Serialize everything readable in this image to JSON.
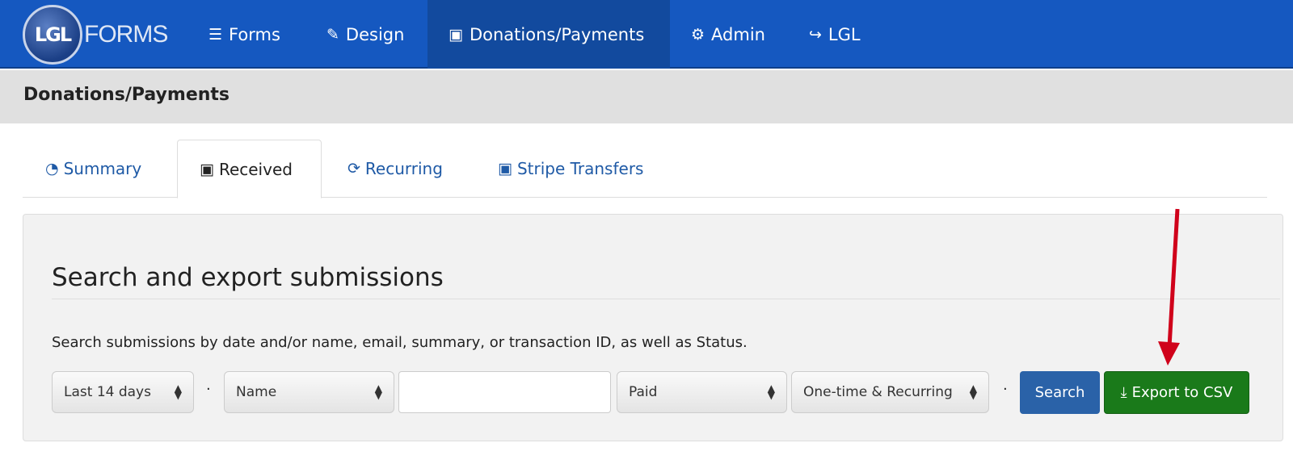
{
  "nav": {
    "logo_text": "LGL FORMS",
    "items": [
      {
        "label": "Forms",
        "icon": "list-icon"
      },
      {
        "label": "Design",
        "icon": "pencil-icon"
      },
      {
        "label": "Donations/Payments",
        "icon": "money-icon",
        "active": true
      },
      {
        "label": "Admin",
        "icon": "gear-icon"
      },
      {
        "label": "LGL",
        "icon": "share-icon"
      }
    ]
  },
  "page_title": "Donations/Payments",
  "tabs": [
    {
      "label": "Summary",
      "icon": "dashboard-icon"
    },
    {
      "label": "Received",
      "icon": "money-icon",
      "active": true
    },
    {
      "label": "Recurring",
      "icon": "refresh-icon"
    },
    {
      "label": "Stripe Transfers",
      "icon": "money-icon"
    }
  ],
  "panel": {
    "heading": "Search and export submissions",
    "description": "Search submissions by date and/or name, email, summary, or transaction ID, as well as Status.",
    "date_range": "Last 14 days",
    "field": "Name",
    "search_value": "",
    "status": "Paid",
    "type": "One-time & Recurring",
    "separator": "·",
    "search_label": "Search",
    "export_label": "Export to CSV"
  },
  "colors": {
    "nav": "#1558c0",
    "search": "#2a62a8",
    "export": "#1a7a1a",
    "arrow": "#d0021b"
  }
}
